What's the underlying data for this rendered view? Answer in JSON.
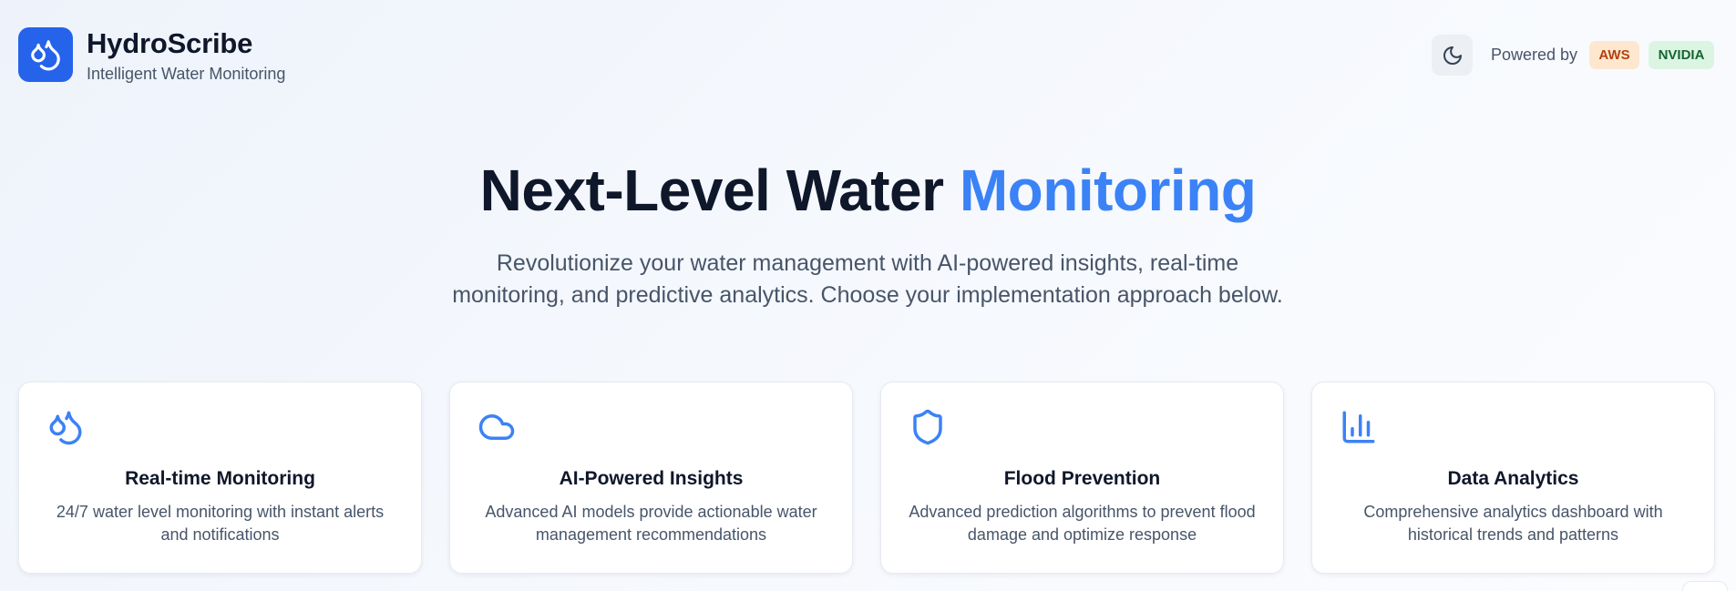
{
  "header": {
    "brand_name": "HydroScribe",
    "brand_tagline": "Intelligent Water Monitoring",
    "logo_icon": "droplets-icon",
    "theme_toggle_icon": "moon-icon",
    "powered_by_label": "Powered by",
    "badges": [
      {
        "label": "AWS",
        "color": "#b4410f",
        "background": "#fde8cf"
      },
      {
        "label": "NVIDIA",
        "color": "#16652f",
        "background": "#dcf5e3"
      }
    ]
  },
  "hero": {
    "title_main": "Next-Level Water ",
    "title_accent": "Monitoring",
    "subtitle": "Revolutionize your water management with AI-powered insights, real-time monitoring, and predictive analytics. Choose your implementation approach below."
  },
  "features": [
    {
      "icon": "droplets-icon",
      "title": "Real-time Monitoring",
      "description": "24/7 water level monitoring with instant alerts and notifications"
    },
    {
      "icon": "cloud-icon",
      "title": "AI-Powered Insights",
      "description": "Advanced AI models provide actionable water management recommendations"
    },
    {
      "icon": "shield-icon",
      "title": "Flood Prevention",
      "description": "Advanced prediction algorithms to prevent flood damage and optimize response"
    },
    {
      "icon": "bar-chart-icon",
      "title": "Data Analytics",
      "description": "Comprehensive analytics dashboard with historical trends and patterns"
    }
  ],
  "colors": {
    "brand": "#2563eb",
    "accent": "#3b82f6",
    "text_primary": "#0f172a",
    "text_secondary": "#475569"
  }
}
